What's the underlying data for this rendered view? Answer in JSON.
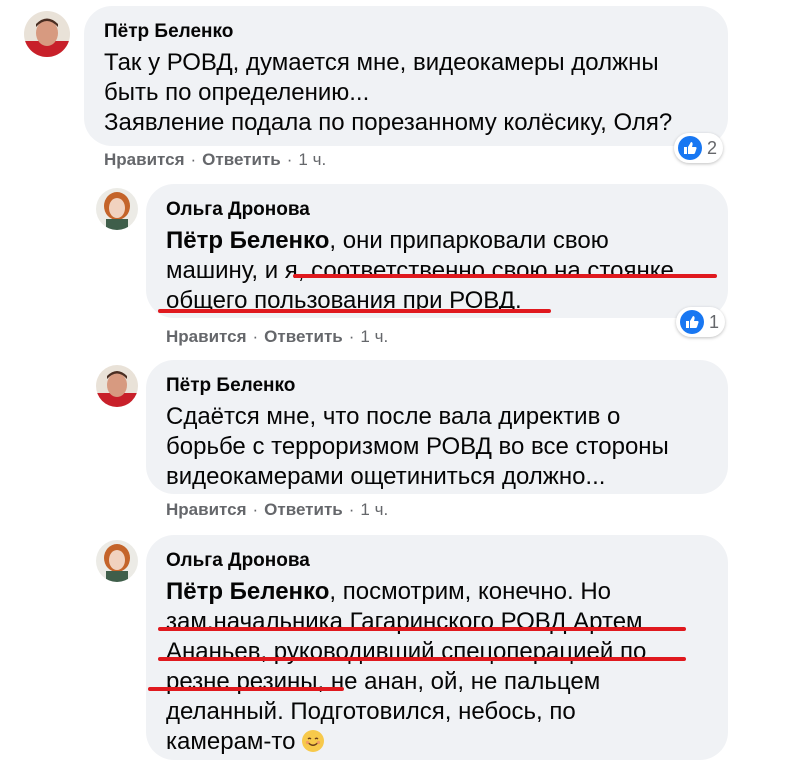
{
  "comments": [
    {
      "author": "Пётр Беленко",
      "lines": [
        "Так у РОВД, думается мне, видеокамеры должны",
        "быть по определению...",
        "Заявление подала по порезанному колёсику, Оля?"
      ],
      "like_label": "Нравится",
      "reply_label": "Ответить",
      "time": "1 ч.",
      "reactions": "2"
    },
    {
      "author": "Ольга Дронова",
      "mention": "Пётр Беленко",
      "lines": [
        ", они припарковали свою",
        "машину, и я, соответственно свою на стоянке",
        "общего пользования при РОВД."
      ],
      "like_label": "Нравится",
      "reply_label": "Ответить",
      "time": "1 ч.",
      "reactions": "1"
    },
    {
      "author": "Пётр Беленко",
      "lines": [
        "Сдаётся мне, что после вала директив о",
        "борьбе с терроризмом РОВД во все стороны",
        "видеокамерами ощетиниться должно..."
      ],
      "like_label": "Нравится",
      "reply_label": "Ответить",
      "time": "1 ч."
    },
    {
      "author": "Ольга Дронова",
      "mention": "Пётр Беленко",
      "lines": [
        ", посмотрим, конечно. Но",
        "зам.начальника Гагаринского РОВД Артем",
        "Ананьев, руководивший спецоперацией по",
        "резне резины, не анан, ой, не пальцем",
        "деланный. Подготовился, небось, по",
        "камерам-то"
      ],
      "emoji": "smiling-face-emoji"
    }
  ],
  "separator": "·",
  "colors": {
    "bubble": "#f0f2f5",
    "like_blue": "#1877f2",
    "underline_red": "#e0191e",
    "meta_gray": "#65676b"
  }
}
